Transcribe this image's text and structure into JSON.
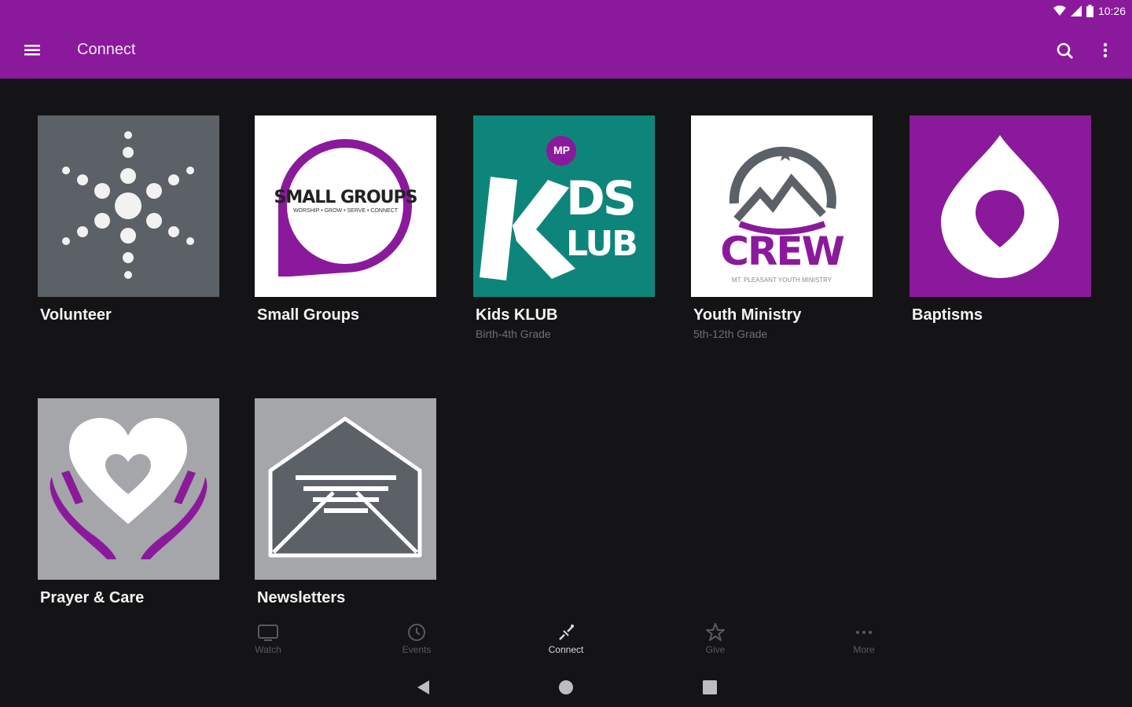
{
  "status_bar": {
    "time": "10:26"
  },
  "app_bar": {
    "title": "Connect",
    "color": "#8a1a9b"
  },
  "tiles": [
    {
      "label": "Volunteer",
      "subtitle": ""
    },
    {
      "label": "Small Groups",
      "subtitle": "",
      "logo_text": "SMALL GROUPS",
      "logo_tagline": "WORSHIP • GROW • SERVE • CONNECT"
    },
    {
      "label": "Kids KLUB",
      "subtitle": "Birth-4th Grade",
      "logo_text_top": "DS",
      "logo_text_bottom": "LUB",
      "logo_badge": "MP"
    },
    {
      "label": "Youth Ministry",
      "subtitle": "5th-12th Grade",
      "logo_text": "CREW",
      "logo_tagline": "MT. PLEASANT YOUTH MINISTRY"
    },
    {
      "label": "Baptisms",
      "subtitle": ""
    },
    {
      "label": "Prayer & Care",
      "subtitle": ""
    },
    {
      "label": "Newsletters",
      "subtitle": ""
    }
  ],
  "bottom_nav": {
    "items": [
      {
        "label": "Watch",
        "icon": "tv-icon"
      },
      {
        "label": "Events",
        "icon": "clock-icon"
      },
      {
        "label": "Connect",
        "icon": "connect-icon",
        "active": true
      },
      {
        "label": "Give",
        "icon": "star-icon"
      },
      {
        "label": "More",
        "icon": "more-horizontal-icon"
      }
    ]
  },
  "colors": {
    "brand_purple": "#8a1a9b",
    "teal": "#0e857a",
    "slate": "#5b6166",
    "background": "#141416"
  }
}
